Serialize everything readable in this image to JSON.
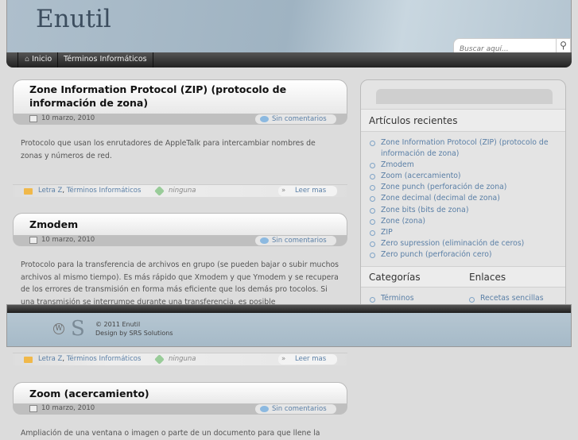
{
  "site": {
    "title": "Enutil",
    "search_placeholder": "Buscar aquí..."
  },
  "nav": {
    "items": [
      {
        "label": "Inicio",
        "icon": "home-icon"
      },
      {
        "label": "Términos Informáticos"
      }
    ]
  },
  "posts": [
    {
      "title": "Zone Information Protocol (ZIP) (protocolo de información de zona)",
      "date": "10 marzo, 2010",
      "comments": "Sin comentarios",
      "text": "Protocolo que usan los enrutadores de AppleTalk para intercambiar nombres de zonas y números de red.",
      "cat1": "Letra Z",
      "cat2": "Términos Informáticos",
      "tags": "ninguna",
      "more": "Leer mas"
    },
    {
      "title": "Zmodem",
      "date": "10 marzo, 2010",
      "comments": "Sin comentarios",
      "text": "Protocolo para la transferencia de archivos en grupo (se pueden bajar o subir muchos archivos al mismo tiempo). Es más rápido que Xmodem y que Ymodem y se recupera de los errores de transmisión en forma más eficiente que los demás pro tocolos. Si una transmisión se interrumpe durante una transferencia, es posible",
      "cat1": "Letra Z",
      "cat2": "Términos Informáticos",
      "tags": "ninguna",
      "more": "Leer mas"
    },
    {
      "title": "Zoom (acercamiento)",
      "date": "10 marzo, 2010",
      "comments": "Sin comentarios",
      "text": "Ampliación de una ventana o imagen o parte de un documento para que llene la"
    }
  ],
  "sidebar": {
    "recent_title": "Artículos recientes",
    "recent": [
      "Zone Information Protocol (ZIP) (protocolo de información de zona)",
      "Zmodem",
      "Zoom (acercamiento)",
      "Zone punch (perforación de zona)",
      "Zone decimal (decimal de zona)",
      "Zone bits (bits de zona)",
      "Zone (zona)",
      "ZIP",
      "Zero supression (eliminación de ceros)",
      "Zero punch (perforación cero)"
    ],
    "categories_title": "Categorías",
    "categories": [
      "Términos"
    ],
    "links_title": "Enlaces",
    "links": [
      "Recetas sencillas"
    ]
  },
  "footer": {
    "copyright": "© 2011 Enutil",
    "design": "Design by SRS Solutions"
  }
}
